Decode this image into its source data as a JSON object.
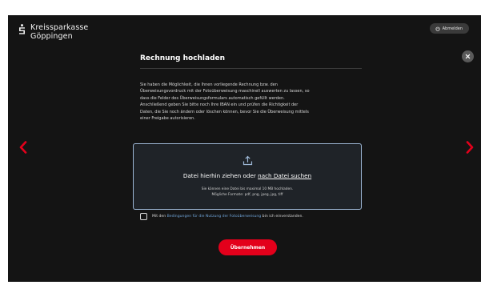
{
  "brand": {
    "line1": "Kreissparkasse",
    "line2": "Göppingen",
    "logo_icon": "sparkasse-s-icon"
  },
  "header": {
    "logout_label": "Abmelden",
    "logout_icon": "power-icon"
  },
  "dialog": {
    "title": "Rechnung hochladen",
    "close_icon": "close-icon",
    "paragraph": [
      "Sie haben die Möglichkeit, die Ihnen vorliegende Rechnung bzw. den",
      "Überweisungsvordruck mit der Fotoüberweisung maschinell auswerten zu lassen, so",
      "dass die Felder des Überweisungsformulars automatisch gefüllt werden.",
      "Anschließend geben Sie bitte noch Ihre IBAN ein und prüfen die Richtigkeit der",
      "Daten, die Sie noch ändern oder löschen können, bevor Sie die Überweisung mittels",
      "einer Freigabe autorisieren."
    ],
    "dropzone": {
      "icon": "upload-icon",
      "main_text": "Datei hierhin ziehen oder ",
      "link_text": "nach Datei suchen",
      "note_line1": "Sie können eine Datei bis maximal 10 MB hochladen.",
      "note_line2": "Mögliche Formate: pdf, png, jpeg, jpg, tiff"
    },
    "consent": {
      "prefix": "Mit den ",
      "link": "Bedingungen für die Nutzung der Fotoüberweisung",
      "suffix": " bin ich einverstanden.",
      "checked": false
    },
    "submit_label": "Übernehmen"
  },
  "navigation": {
    "prev_icon": "chevron-left-icon",
    "next_icon": "chevron-right-icon"
  },
  "colors": {
    "background": "#141414",
    "accent": "#e3001b",
    "link": "#6fa3d6",
    "dropzone_border": "#9db7d6"
  }
}
